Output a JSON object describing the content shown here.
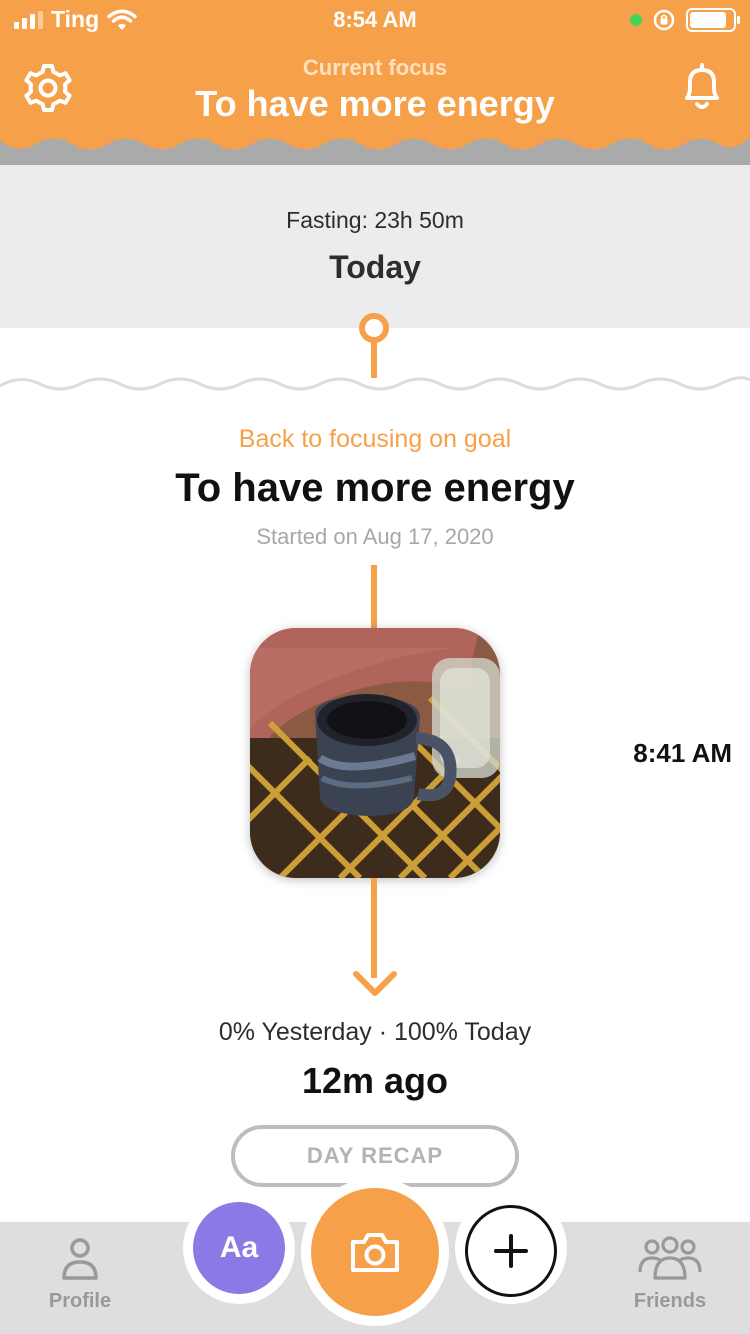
{
  "status_bar": {
    "carrier": "Ting",
    "time": "8:54 AM"
  },
  "header": {
    "subtitle": "Current focus",
    "title": "To have more energy"
  },
  "today": {
    "fasting": "Fasting: 23h 50m",
    "label": "Today"
  },
  "goal": {
    "subtitle": "Back to focusing on goal",
    "title": "To have more energy",
    "started": "Started on Aug 17, 2020"
  },
  "entry": {
    "time": "8:41 AM"
  },
  "summary": {
    "progress": "0% Yesterday · 100% Today",
    "ago": "12m ago",
    "recap_label": "DAY RECAP"
  },
  "tabs": {
    "profile": "Profile",
    "text_button": "Aa",
    "friends": "Friends"
  },
  "colors": {
    "accent": "#f7a04a",
    "purple": "#8d79e6",
    "header_bottom": "#aaaaaa",
    "band": "#ececec"
  },
  "icons": {
    "settings": "gear-icon",
    "notifications": "bell-icon",
    "camera": "camera-icon",
    "add": "plus-icon",
    "profile": "person-icon",
    "friends": "group-icon"
  }
}
